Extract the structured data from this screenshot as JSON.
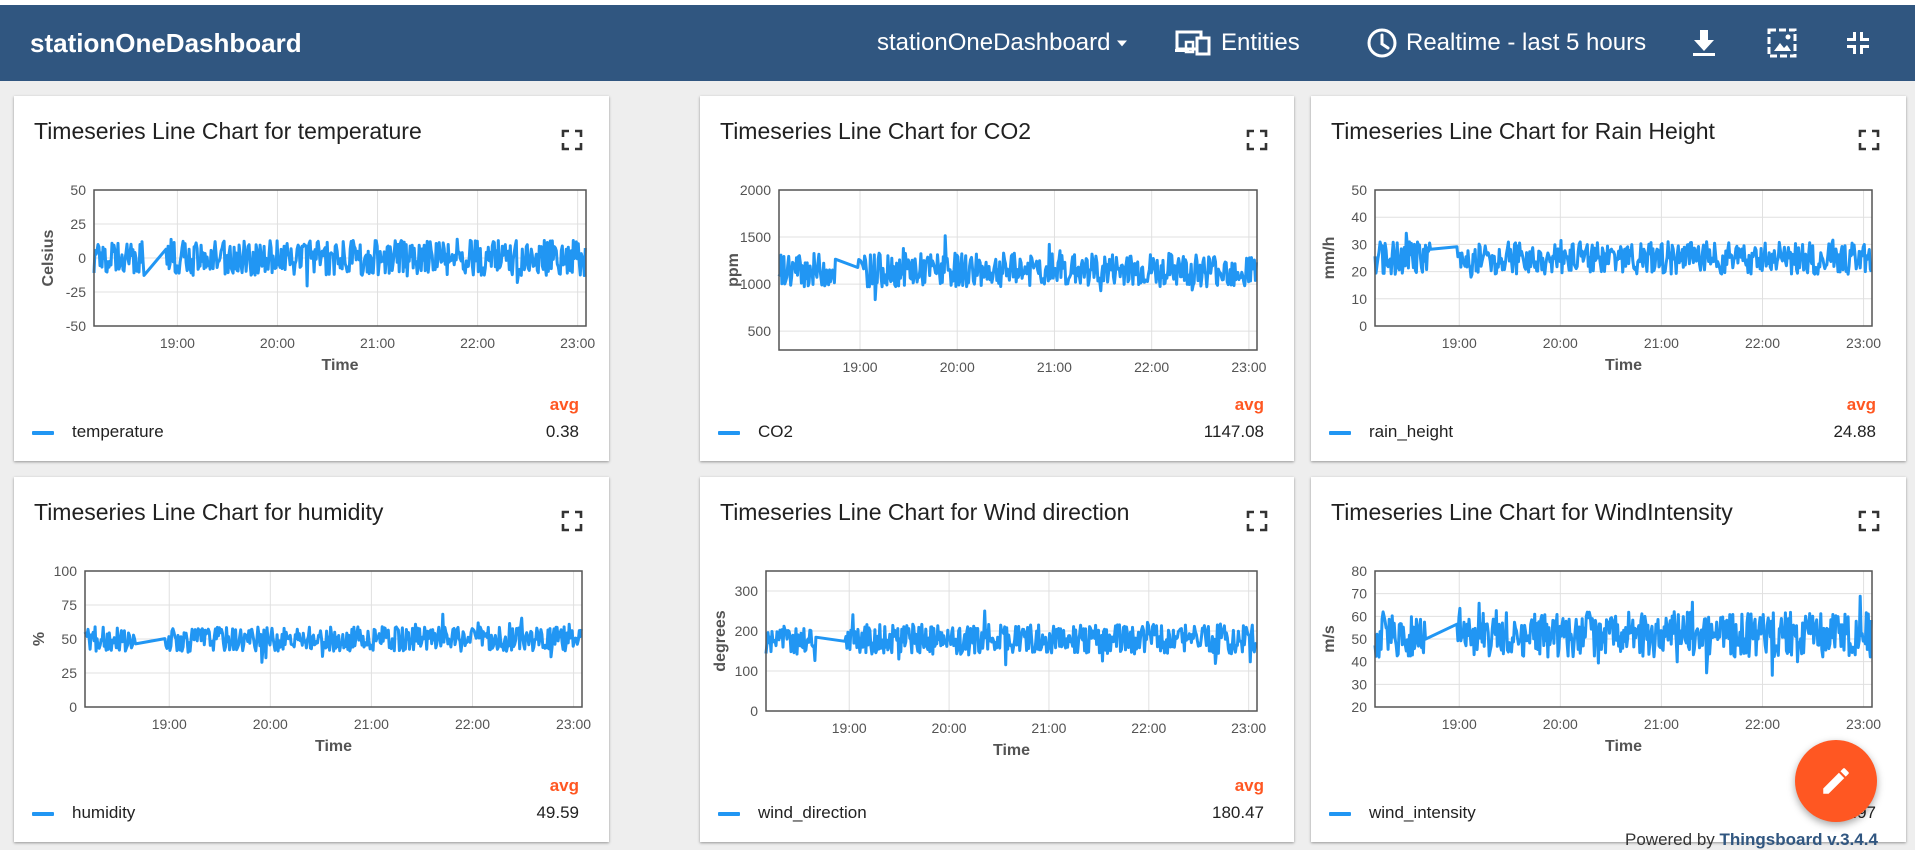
{
  "header": {
    "title": "stationOneDashboard",
    "dashboard_select": "stationOneDashboard",
    "entities_label": "Entities",
    "timewindow_label": "Realtime - last 5 hours",
    "icons": [
      "arrow-drop-down-icon",
      "devices-icon",
      "clock-icon",
      "download-icon",
      "image-export-icon",
      "fullscreen-exit-icon"
    ]
  },
  "colors": {
    "toolbar": "#305680",
    "series": "#2196f3",
    "accent": "#ff5722"
  },
  "x_tick_labels": [
    "19:00",
    "20:00",
    "21:00",
    "22:00",
    "23:00"
  ],
  "legend_header": "avg",
  "widgets": [
    {
      "title": "Timeseries Line Chart for temperature",
      "key": "temperature",
      "avg": "0.38",
      "ylabel": "Celsius",
      "xlabel": "Time",
      "ticks": [
        "50",
        "25",
        "0",
        "-25",
        "-50"
      ]
    },
    {
      "title": "Timeseries Line Chart for CO2",
      "key": "CO2",
      "avg": "1147.08",
      "ylabel": "ppm",
      "xlabel": "",
      "ticks": [
        "2000",
        "1500",
        "1000",
        "500"
      ]
    },
    {
      "title": "Timeseries Line Chart for Rain Height",
      "key": "rain_height",
      "avg": "24.88",
      "ylabel": "mm/h",
      "xlabel": "Time",
      "ticks": [
        "50",
        "40",
        "30",
        "20",
        "10",
        "0"
      ]
    },
    {
      "title": "Timeseries Line Chart for humidity",
      "key": "humidity",
      "avg": "49.59",
      "ylabel": "%",
      "xlabel": "Time",
      "ticks": [
        "100",
        "75",
        "50",
        "25",
        "0"
      ]
    },
    {
      "title": "Timeseries Line Chart for Wind direction",
      "key": "wind_direction",
      "avg": "180.47",
      "ylabel": "degrees",
      "xlabel": "Time",
      "ticks": [
        "300",
        "200",
        "100",
        "0"
      ]
    },
    {
      "title": "Timeseries Line Chart for WindIntensity",
      "key": "wind_intensity",
      "avg": "53.97",
      "ylabel": "m/s",
      "xlabel": "Time",
      "ticks": [
        "80",
        "70",
        "60",
        "50",
        "40",
        "30",
        "20"
      ]
    }
  ],
  "chart_data": [
    {
      "type": "line",
      "title": "Timeseries Line Chart for temperature",
      "xlabel": "Time",
      "ylabel": "Celsius",
      "x_range": [
        "18:10",
        "23:05"
      ],
      "ylim": [
        -50,
        50
      ],
      "gap": [
        "18:40",
        "18:53"
      ],
      "series": [
        {
          "name": "temperature",
          "center": 0,
          "amplitude": 13,
          "avg": 0.38
        }
      ],
      "x_ticks": [
        "19:00",
        "20:00",
        "21:00",
        "22:00",
        "23:00"
      ],
      "grid": true,
      "legend": "bottom"
    },
    {
      "type": "line",
      "title": "Timeseries Line Chart for CO2",
      "xlabel": "",
      "ylabel": "ppm",
      "x_range": [
        "18:10",
        "23:05"
      ],
      "ylim": [
        300,
        2000
      ],
      "gap": [
        "18:45",
        "18:58"
      ],
      "series": [
        {
          "name": "CO2",
          "center": 1150,
          "amplitude": 180,
          "avg": 1147.08
        }
      ],
      "x_ticks": [
        "19:00",
        "20:00",
        "21:00",
        "22:00",
        "23:00"
      ],
      "grid": true,
      "legend": "bottom"
    },
    {
      "type": "line",
      "title": "Timeseries Line Chart for Rain Height",
      "xlabel": "Time",
      "ylabel": "mm/h",
      "x_range": [
        "18:10",
        "23:05"
      ],
      "ylim": [
        0,
        50
      ],
      "gap": [
        "18:43",
        "18:58"
      ],
      "series": [
        {
          "name": "rain_height",
          "center": 25,
          "amplitude": 6,
          "avg": 24.88
        }
      ],
      "x_ticks": [
        "19:00",
        "20:00",
        "21:00",
        "22:00",
        "23:00"
      ],
      "grid": true,
      "legend": "bottom"
    },
    {
      "type": "line",
      "title": "Timeseries Line Chart for humidity",
      "xlabel": "Time",
      "ylabel": "%",
      "x_range": [
        "18:10",
        "23:05"
      ],
      "ylim": [
        0,
        100
      ],
      "gap": [
        "18:40",
        "18:57"
      ],
      "series": [
        {
          "name": "humidity",
          "center": 50,
          "amplitude": 9,
          "avg": 49.59
        }
      ],
      "x_ticks": [
        "19:00",
        "20:00",
        "21:00",
        "22:00",
        "23:00"
      ],
      "grid": true,
      "legend": "bottom"
    },
    {
      "type": "line",
      "title": "Timeseries Line Chart for Wind direction",
      "xlabel": "Time",
      "ylabel": "degrees",
      "x_range": [
        "18:10",
        "23:05"
      ],
      "ylim": [
        0,
        350
      ],
      "gap": [
        "18:40",
        "18:57"
      ],
      "series": [
        {
          "name": "wind_direction",
          "center": 180,
          "amplitude": 38,
          "avg": 180.47
        }
      ],
      "x_ticks": [
        "19:00",
        "20:00",
        "21:00",
        "22:00",
        "23:00"
      ],
      "grid": true,
      "legend": "bottom"
    },
    {
      "type": "line",
      "title": "Timeseries Line Chart for WindIntensity",
      "xlabel": "Time",
      "ylabel": "m/s",
      "x_range": [
        "18:10",
        "23:05"
      ],
      "ylim": [
        20,
        80
      ],
      "gap": [
        "18:40",
        "18:58"
      ],
      "series": [
        {
          "name": "wind_intensity",
          "center": 52,
          "amplitude": 10,
          "avg": 53.97
        }
      ],
      "x_ticks": [
        "19:00",
        "20:00",
        "21:00",
        "22:00",
        "23:00"
      ],
      "grid": true,
      "legend": "bottom"
    }
  ],
  "footer": {
    "powered_by": "Powered by",
    "brand": "Thingsboard v.3.4.4"
  }
}
